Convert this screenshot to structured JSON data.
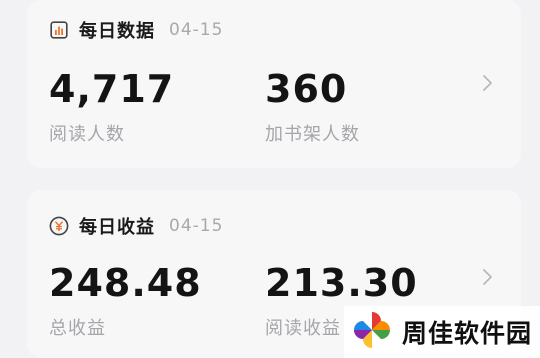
{
  "daily_card": {
    "title": "每日数据",
    "date": "04-15",
    "icon": "bar-chart-icon",
    "metrics": [
      {
        "value": "4,717",
        "label": "阅读人数"
      },
      {
        "value": "360",
        "label": "加书架人数"
      }
    ]
  },
  "income_card": {
    "title": "每日收益",
    "date": "04-15",
    "icon": "yen-coin-icon",
    "metrics": [
      {
        "value": "248.48",
        "label": "总收益"
      },
      {
        "value": "213.30",
        "label": "阅读收益"
      }
    ]
  },
  "watermark": {
    "text": "周佳软件园",
    "icon": "pinwheel-logo-icon"
  },
  "colors": {
    "background": "#f2f2f4",
    "card": "#f7f7f8",
    "value_text": "#141414",
    "label_text": "#a5a5aa",
    "icon_orange": "#e8772e"
  }
}
